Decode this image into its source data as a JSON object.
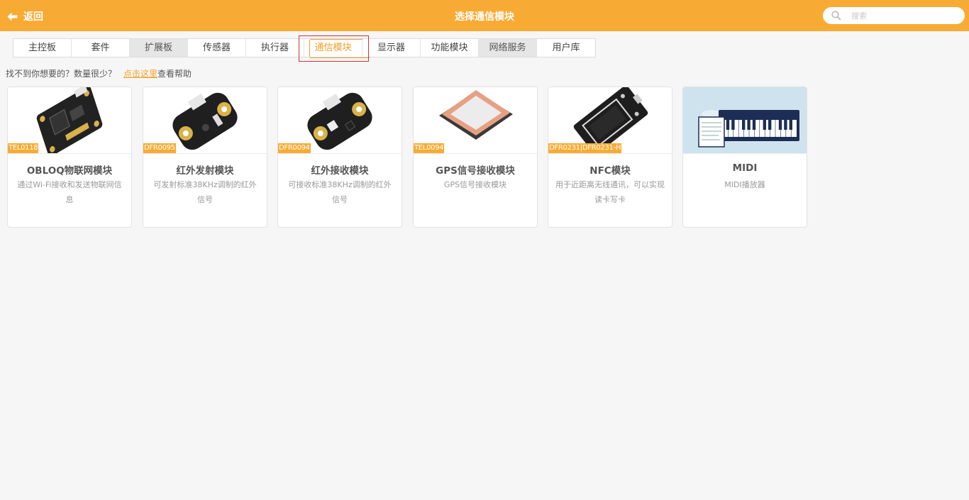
{
  "header": {
    "back_label": "返回",
    "title": "选择通信模块",
    "search_placeholder": "搜索",
    "bg_color": "#f8ab34"
  },
  "tabs": [
    {
      "label": "主控板",
      "state": "normal"
    },
    {
      "label": "套件",
      "state": "normal"
    },
    {
      "label": "扩展板",
      "state": "gray"
    },
    {
      "label": "传感器",
      "state": "normal"
    },
    {
      "label": "执行器",
      "state": "normal"
    },
    {
      "label": "通信模块",
      "state": "active"
    },
    {
      "label": "显示器",
      "state": "normal"
    },
    {
      "label": "功能模块",
      "state": "normal"
    },
    {
      "label": "网络服务",
      "state": "gray"
    },
    {
      "label": "用户库",
      "state": "normal"
    }
  ],
  "help": {
    "text": "找不到你想要的？数量很少？",
    "link": "点击这里",
    "suffix": "查看帮助"
  },
  "cards": [
    {
      "sku": "TEL0118",
      "name": "OBLOQ物联网模块",
      "desc": "通过Wi-Fi接收和发送物联网信息",
      "icon": "obloq-board-icon"
    },
    {
      "sku": "DFR0095",
      "name": "红外发射模块",
      "desc": "可发射标准38KHz调制的红外信号",
      "icon": "ir-transmitter-board-icon"
    },
    {
      "sku": "DFR0094",
      "name": "红外接收模块",
      "desc": "可接收标准38KHz调制的红外信号",
      "icon": "ir-receiver-board-icon"
    },
    {
      "sku": "TEL0094",
      "name": "GPS信号接收模块",
      "desc": "GPS信号接收模块",
      "icon": "gps-antenna-icon"
    },
    {
      "sku": "DFR0231|DFR0231-H",
      "name": "NFC模块",
      "desc": "用于近距离无线通讯，可以实现读卡写卡",
      "icon": "nfc-board-icon"
    },
    {
      "sku": "",
      "name": "MIDI",
      "desc": "MIDI播放器",
      "icon": "midi-keyboard-icon"
    }
  ]
}
